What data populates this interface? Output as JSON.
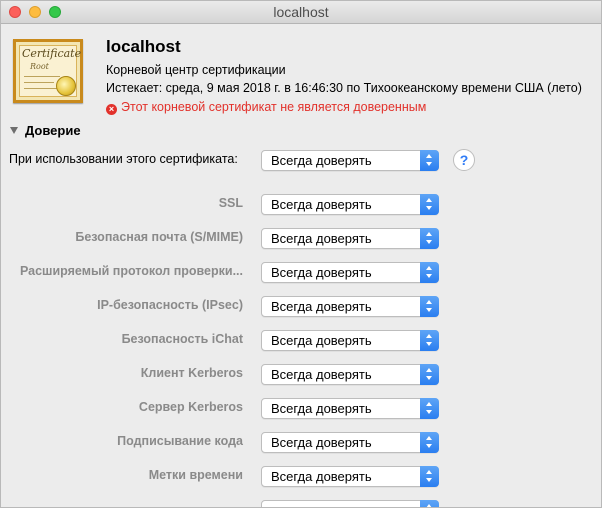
{
  "window": {
    "title": "localhost"
  },
  "certificate": {
    "thumb_word": "Certificate",
    "thumb_sub": "Root",
    "name": "localhost",
    "kind": "Корневой центр сертификации",
    "expires": "Истекает: среда, 9 мая 2018 г. в 16:46:30 по Тихоокеанскому времени США (лето)",
    "warning": "Этот корневой сертификат не является доверенным",
    "warning_color": "#e2312b"
  },
  "trust": {
    "section_label": "Доверие",
    "main_label": "При использовании этого сертификата:",
    "main_value": "Всегда доверять",
    "help_label": "?",
    "rows": [
      {
        "label": "SSL",
        "value": "Всегда доверять"
      },
      {
        "label": "Безопасная почта (S/MIME)",
        "value": "Всегда доверять"
      },
      {
        "label": "Расширяемый протокол проверки...",
        "value": "Всегда доверять"
      },
      {
        "label": "IP-безопасность (IPsec)",
        "value": "Всегда доверять"
      },
      {
        "label": "Безопасность iChat",
        "value": "Всегда доверять"
      },
      {
        "label": "Клиент Kerberos",
        "value": "Всегда доверять"
      },
      {
        "label": "Сервер Kerberos",
        "value": "Всегда доверять"
      },
      {
        "label": "Подписывание кода",
        "value": "Всегда доверять"
      },
      {
        "label": "Метки времени",
        "value": "Всегда доверять"
      }
    ]
  },
  "colors": {
    "accent": "#2a7ef0",
    "close": "#fc605b",
    "minimize": "#fdbc40",
    "maximize": "#34c84a"
  }
}
